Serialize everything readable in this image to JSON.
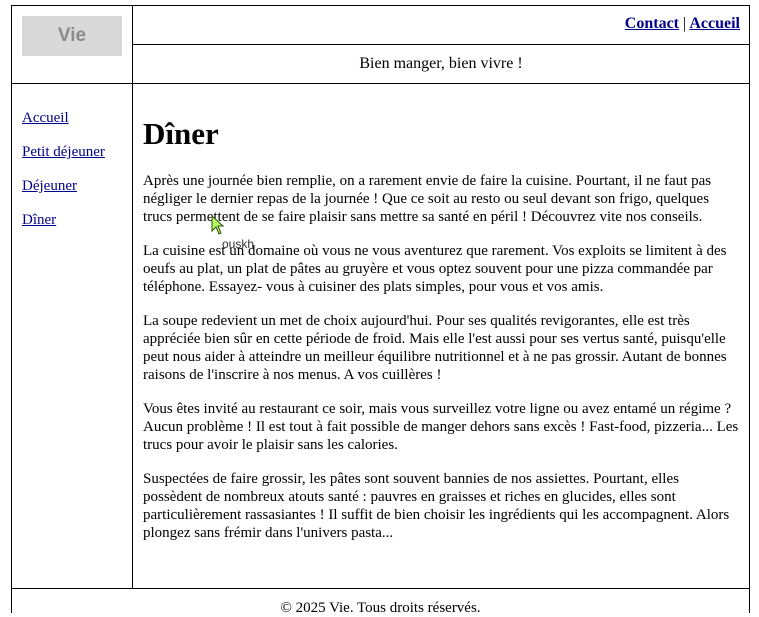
{
  "header": {
    "logo_text": "Vie",
    "nav": {
      "contact": "Contact",
      "separator": "|",
      "accueil": "Accueil"
    },
    "tagline": "Bien manger, bien vivre !"
  },
  "sidebar": {
    "items": [
      {
        "label": "Accueil"
      },
      {
        "label": "Petit déjeuner"
      },
      {
        "label": "Déjeuner"
      },
      {
        "label": "Dîner"
      }
    ]
  },
  "main": {
    "title": "Dîner",
    "paragraphs": [
      "Après une journée bien remplie, on a rarement envie de faire la cuisine. Pourtant, il ne faut pas négliger le dernier repas de la journée ! Que ce soit au resto ou seul devant son frigo, quelques trucs permettent de se faire plaisir sans mettre sa santé en péril ! Découvrez vite nos conseils.",
      "La cuisine est un domaine où vous ne vous aventurez que rarement. Vos exploits se limitent à des oeufs au plat, un plat de pâtes au gruyère et vous optez souvent pour une pizza commandée par téléphone. Essayez- vous à cuisiner des plats simples, pour vous et vos amis.",
      "La soupe redevient un met de choix aujourd'hui. Pour ses qualités revigorantes, elle est très appréciée bien sûr en cette période de froid. Mais elle l'est aussi pour ses vertus santé, puisqu'elle peut nous aider à atteindre un meilleur équilibre nutritionnel et à ne pas grossir. Autant de bonnes raisons de l'inscrire à nos menus. A vos cuillères !",
      "Vous êtes invité au restaurant ce soir, mais vous surveillez votre ligne ou avez entamé un régime ? Aucun problème ! Il est tout à fait possible de manger dehors sans excès ! Fast-food, pizzeria... Les trucs pour avoir le plaisir sans les calories.",
      "Suspectées de faire grossir, les pâtes sont souvent bannies de nos assiettes. Pourtant, elles possèdent de nombreux atouts santé : pauvres en graisses et riches en glucides, elles sont particulièrement rassasiantes ! Il suffit de bien choisir les ingrédients qui les accompagnent. Alors plongez sans frémir dans l'univers pasta..."
    ]
  },
  "footer": {
    "text": "© 2025 Vie. Tous droits réservés."
  },
  "cursor": {
    "tooltip": "ouskh"
  },
  "colors": {
    "link": "#00008b",
    "logo_bg": "#d9d9d9",
    "logo_text": "#8a8a8a",
    "border": "#000000"
  }
}
